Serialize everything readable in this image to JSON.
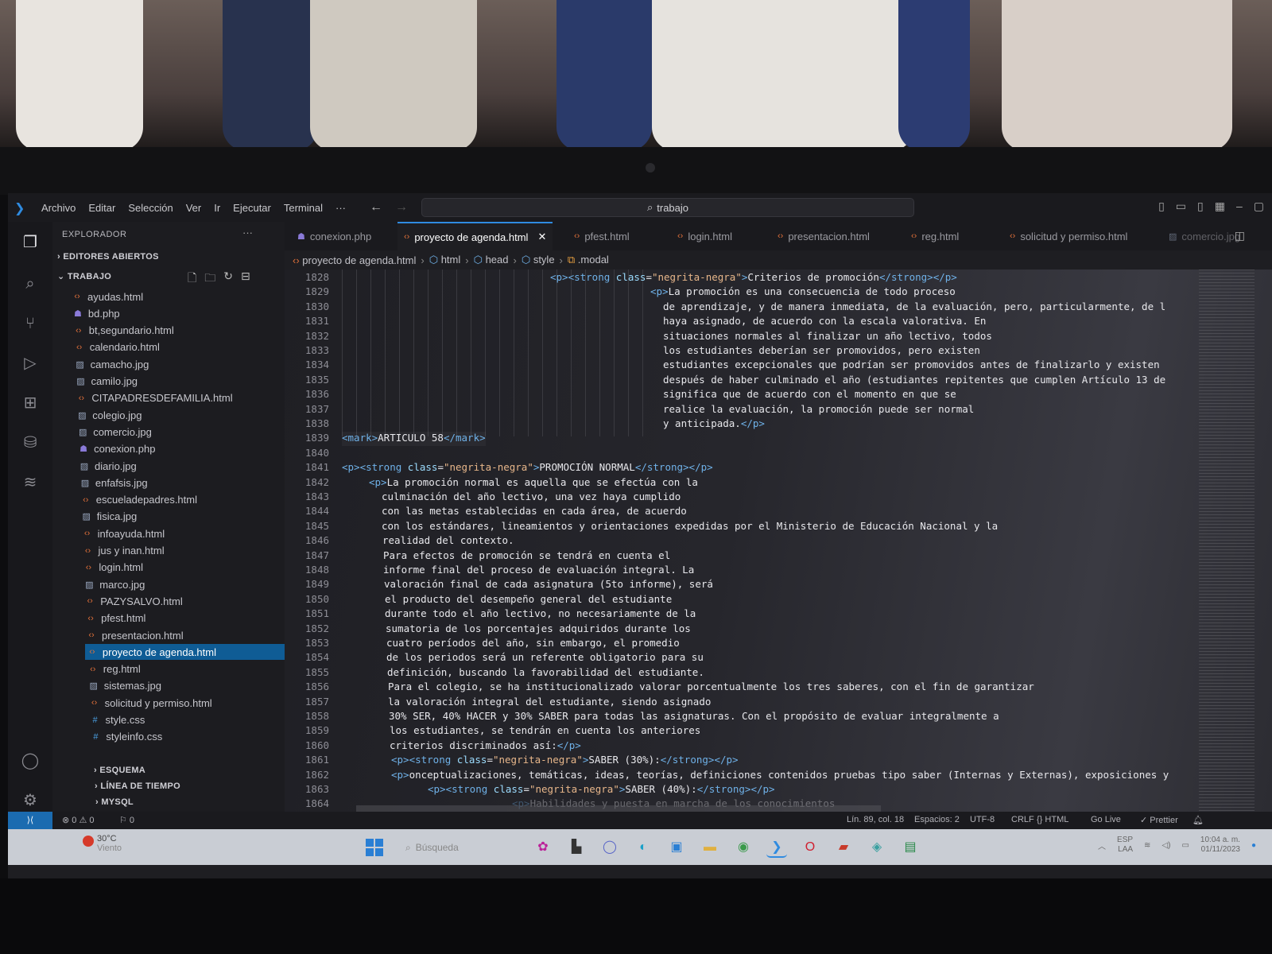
{
  "menu": {
    "items": [
      "Archivo",
      "Editar",
      "Selección",
      "Ver",
      "Ir",
      "Ejecutar",
      "Terminal",
      "···"
    ],
    "search": "trabajo"
  },
  "sidebar": {
    "title": "EXPLORADOR",
    "more": "···",
    "open_editors": "EDITORES ABIERTOS",
    "workspace": "TRABAJO",
    "files": [
      {
        "name": "ayudas.html",
        "type": "html"
      },
      {
        "name": "bd.php",
        "type": "php"
      },
      {
        "name": "bt,segundario.html",
        "type": "html"
      },
      {
        "name": "calendario.html",
        "type": "html"
      },
      {
        "name": "camacho.jpg",
        "type": "img"
      },
      {
        "name": "camilo.jpg",
        "type": "img"
      },
      {
        "name": "CITAPADRESDEFAMILIA.html",
        "type": "html"
      },
      {
        "name": "colegio.jpg",
        "type": "img"
      },
      {
        "name": "comercio.jpg",
        "type": "img"
      },
      {
        "name": "conexion.php",
        "type": "php"
      },
      {
        "name": "diario.jpg",
        "type": "img"
      },
      {
        "name": "enfafsis.jpg",
        "type": "img"
      },
      {
        "name": "escueladepadres.html",
        "type": "html"
      },
      {
        "name": "fisica.jpg",
        "type": "img"
      },
      {
        "name": "infoayuda.html",
        "type": "html"
      },
      {
        "name": "jus y inan.html",
        "type": "html"
      },
      {
        "name": "login.html",
        "type": "html"
      },
      {
        "name": "marco.jpg",
        "type": "img"
      },
      {
        "name": "PAZYSALVO.html",
        "type": "html"
      },
      {
        "name": "pfest.html",
        "type": "html"
      },
      {
        "name": "presentacion.html",
        "type": "html"
      },
      {
        "name": "proyecto de agenda.html",
        "type": "html",
        "selected": true
      },
      {
        "name": "reg.html",
        "type": "html"
      },
      {
        "name": "sistemas.jpg",
        "type": "img"
      },
      {
        "name": "solicitud y permiso.html",
        "type": "html"
      },
      {
        "name": "style.css",
        "type": "css"
      },
      {
        "name": "styleinfo.css",
        "type": "css"
      }
    ],
    "bottom_sections": [
      "ESQUEMA",
      "LÍNEA DE TIEMPO",
      "MYSQL"
    ]
  },
  "tabs": [
    {
      "label": "conexion.php",
      "type": "php"
    },
    {
      "label": "proyecto de agenda.html",
      "type": "html",
      "active": true
    },
    {
      "label": "pfest.html",
      "type": "html"
    },
    {
      "label": "login.html",
      "type": "html"
    },
    {
      "label": "presentacion.html",
      "type": "html"
    },
    {
      "label": "reg.html",
      "type": "html"
    },
    {
      "label": "solicitud y permiso.html",
      "type": "html"
    },
    {
      "label": "comercio.jpg",
      "type": "img"
    }
  ],
  "breadcrumb": [
    "proyecto de agenda.html",
    "html",
    "head",
    "style",
    ".modal"
  ],
  "code": {
    "line_numbers": [
      1828,
      1829,
      1830,
      1831,
      1832,
      1833,
      1834,
      1835,
      1836,
      1837,
      1838,
      1839,
      1840,
      1841,
      1842,
      1843,
      1844,
      1845,
      1846,
      1847,
      1848,
      1849,
      1850,
      1851,
      1852,
      1853,
      1854,
      1855,
      1856,
      1857,
      1858,
      1859,
      1860,
      1861,
      1862,
      1863,
      1864
    ],
    "lines": [
      "<p><strong class=\"negrita-negra\">Criterios de promoción</strong></p>",
      "<p>La promoción es una consecuencia de todo proceso",
      "de aprendizaje, y de manera inmediata, de la evaluación, pero, particularmente, de l",
      "haya asignado, de acuerdo con la escala valorativa. En",
      "situaciones normales al finalizar un año lectivo, todos",
      "los estudiantes deberían ser promovidos, pero existen",
      "estudiantes excepcionales que podrían ser promovidos antes de finalizarlo y existen",
      "después de haber culminado el año (estudiantes repitentes que cumplen Artículo 13 de",
      "significa que de acuerdo con el momento en que se",
      "realice la evaluación, la promoción puede ser normal",
      "y anticipada.</p>",
      "<mark>ARTICULO 58</mark>",
      "",
      "<p><strong class=\"negrita-negra\">PROMOCIÓN NORMAL</strong></p>",
      "<p>La promoción normal es aquella que se efectúa con la",
      "culminación del año lectivo, una vez haya cumplido",
      "con las metas establecidas en cada área, de acuerdo",
      "con los estándares, lineamientos y orientaciones expedidas por el Ministerio de Educación Nacional y la",
      "realidad del contexto.",
      "Para efectos de promoción se tendrá en cuenta el",
      "informe final del proceso de evaluación integral. La",
      "valoración final de cada asignatura (5to informe), será",
      "el producto del desempeño general del estudiante",
      "durante todo el año lectivo, no necesariamente de la",
      "sumatoria de los porcentajes adquiridos durante los",
      "cuatro períodos del año, sin embargo, el promedio",
      "de los periodos será un referente obligatorio para su",
      "definición, buscando la favorabilidad del estudiante.",
      "Para el colegio, se ha institucionalizado valorar porcentualmente los tres saberes, con el fin de garantizar",
      "la valoración integral del estudiante, siendo asignado",
      "30% SER, 40% HACER y 30% SABER para todas las asignaturas. Con el propósito de evaluar integralmente a",
      "los estudiantes, se tendrán en cuenta los anteriores",
      "criterios discriminados así:</p>",
      "<p><strong class=\"negrita-negra\">SABER (30%):</strong></p>",
      "<p>onceptualizaciones, temáticas, ideas, teorías, definiciones contenidos pruebas tipo saber (Internas y Externas), exposiciones y",
      "<p><strong class=\"negrita-negra\">SABER (40%):</strong></p>",
      "<p>Habilidades y puesta en marcha de los conocimientos"
    ]
  },
  "statusbar": {
    "errors": "⊗ 0 ⚠ 0",
    "ports": "⚐ 0",
    "position": "Lín. 89, col. 18",
    "spaces": "Espacios: 2",
    "encoding": "UTF-8",
    "eol": "CRLF",
    "language": "{} HTML",
    "golive": "Go Live",
    "prettier": "✓ Prettier"
  },
  "taskbar": {
    "weather_temp": "30°C",
    "weather_desc": "Viento",
    "search": "Búsqueda",
    "lang": "ESP",
    "lang2": "LAA",
    "time": "10:04 a. m.",
    "date": "01/11/2023"
  },
  "colors": {
    "accent": "#2f8be0",
    "selection": "#0f5c95",
    "html_icon": "#e0703a",
    "php_icon": "#8a7ad8"
  }
}
